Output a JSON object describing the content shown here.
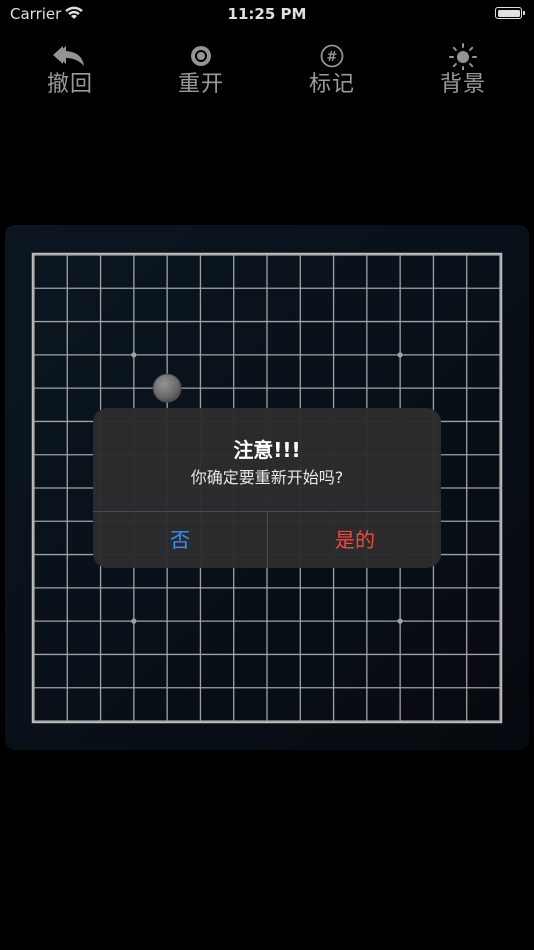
{
  "status_bar": {
    "carrier": "Carrier",
    "time": "11:25 PM"
  },
  "toolbar": {
    "items": [
      {
        "label": "撤回",
        "icon": "undo-arrows-icon"
      },
      {
        "label": "重开",
        "icon": "restart-circle-icon"
      },
      {
        "label": "标记",
        "icon": "hash-circle-icon"
      },
      {
        "label": "背景",
        "icon": "sun-icon"
      }
    ]
  },
  "board": {
    "lines": 15,
    "star_points": [
      [
        3,
        3
      ],
      [
        11,
        3
      ],
      [
        3,
        11
      ],
      [
        11,
        11
      ]
    ],
    "stones": [
      {
        "col": 4,
        "row": 4,
        "color": "gray"
      }
    ],
    "line_color": "#b9b9b9",
    "stone_color": "#8a8a8a"
  },
  "dialog": {
    "title": "注意!!!",
    "message": "你确定要重新开始吗?",
    "buttons": [
      {
        "label": "否",
        "color": "#3d8ff5"
      },
      {
        "label": "是的",
        "color": "#f04a3e"
      }
    ]
  }
}
